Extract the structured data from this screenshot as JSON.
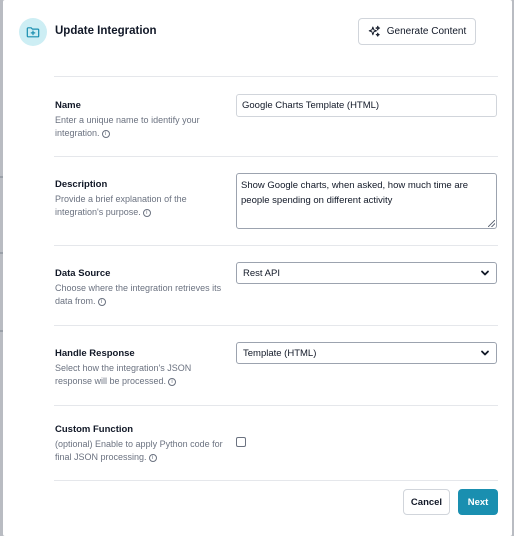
{
  "header": {
    "icon": "folder-plus-icon",
    "title": "Update Integration",
    "generate_button": {
      "icon": "sparkles-icon",
      "label": "Generate Content"
    }
  },
  "fields": {
    "name": {
      "label": "Name",
      "help": "Enter a unique name to identify your integration.",
      "value": "Google Charts Template (HTML)"
    },
    "description": {
      "label": "Description",
      "help": "Provide a brief explanation of the integration's purpose.",
      "value": "Show Google charts, when asked, how much time are people spending on different activity"
    },
    "data_source": {
      "label": "Data Source",
      "help": "Choose where the integration retrieves its data from.",
      "selected": "Rest API"
    },
    "handle_response": {
      "label": "Handle Response",
      "help": "Select how the integration's JSON response will be processed.",
      "selected": "Template (HTML)"
    },
    "custom_function": {
      "label": "Custom Function",
      "help": "(optional) Enable to apply Python code for final JSON processing.",
      "checked": false
    }
  },
  "footer": {
    "cancel_label": "Cancel",
    "next_label": "Next"
  },
  "colors": {
    "accent": "#1a8fb0",
    "icon_bg": "#cdeef4"
  }
}
